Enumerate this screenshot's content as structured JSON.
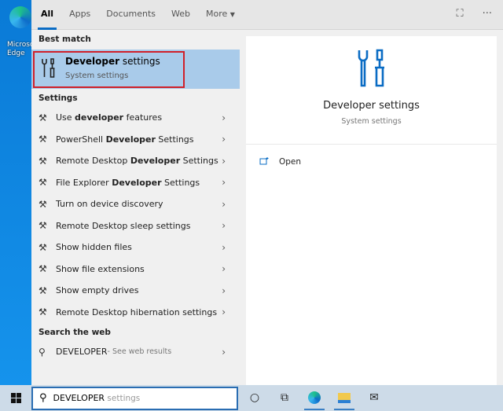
{
  "desktop": {
    "icon_label": "Microsoft Edge",
    "icon": "edge-icon"
  },
  "tabs": [
    "All",
    "Apps",
    "Documents",
    "Web",
    "More"
  ],
  "top_icons": [
    "feedback-icon",
    "more-options-icon"
  ],
  "top_more_glyph": "···",
  "best_match": {
    "header": "Best match",
    "title_bold": "Developer",
    "title_rest": " settings",
    "subtitle": "System settings",
    "icon": "tools-icon"
  },
  "settings": {
    "header": "Settings",
    "items": [
      {
        "pre": "Use ",
        "bold": "developer",
        "post": " features"
      },
      {
        "pre": "PowerShell ",
        "bold": "Developer",
        "post": " Settings"
      },
      {
        "pre": "Remote Desktop ",
        "bold": "Developer",
        "post": " Settings"
      },
      {
        "pre": "File Explorer ",
        "bold": "Developer",
        "post": " Settings"
      },
      {
        "pre": "Turn on device discovery",
        "bold": "",
        "post": ""
      },
      {
        "pre": "Remote Desktop sleep settings",
        "bold": "",
        "post": ""
      },
      {
        "pre": "Show hidden files",
        "bold": "",
        "post": ""
      },
      {
        "pre": "Show file extensions",
        "bold": "",
        "post": ""
      },
      {
        "pre": "Show empty drives",
        "bold": "",
        "post": ""
      },
      {
        "pre": "Remote Desktop hibernation settings",
        "bold": "",
        "post": ""
      }
    ]
  },
  "web": {
    "header": "Search the web",
    "query": "DEVELOPER",
    "suffix": " - See web results"
  },
  "preview": {
    "title": "Developer settings",
    "subtitle": "System settings",
    "action": "Open",
    "accent": "#0a6cc4"
  },
  "taskbar": {
    "search_typed": "DEVELOPER",
    "search_suggest": " settings"
  }
}
